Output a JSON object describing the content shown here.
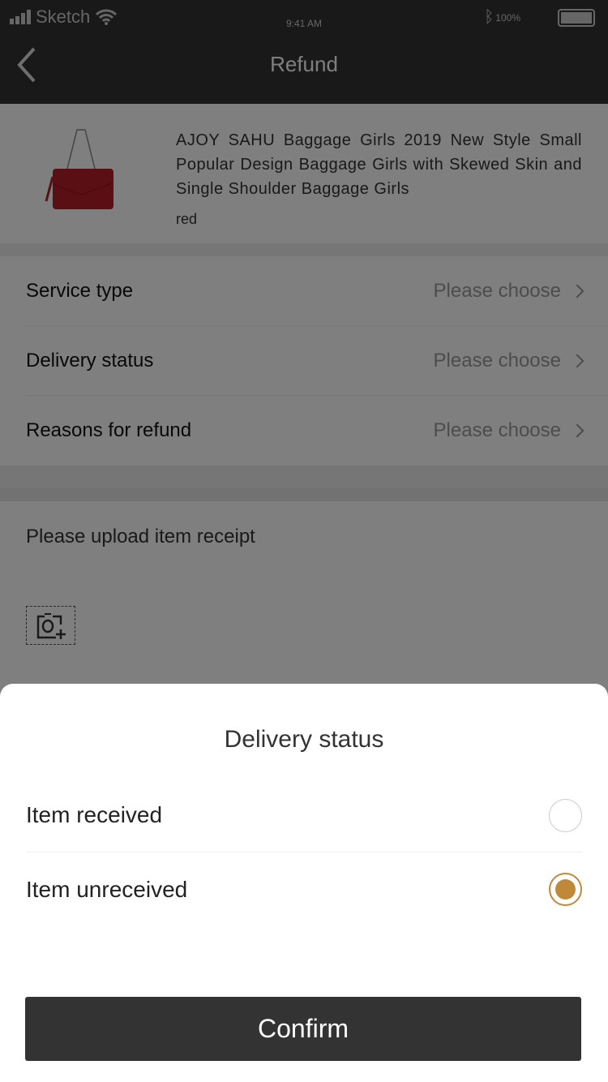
{
  "status_bar": {
    "carrier": "Sketch",
    "time": "9:41 AM",
    "battery": "100%"
  },
  "nav": {
    "title": "Refund"
  },
  "product": {
    "title": "AJOY SAHU Baggage Girls 2019 New Style Small Popular Design Baggage Girls with Skewed Skin and Single Shoulder Baggage Girls",
    "color": "red"
  },
  "form": {
    "rows": [
      {
        "label": "Service type",
        "value": "Please choose"
      },
      {
        "label": "Delivery status",
        "value": "Please choose"
      },
      {
        "label": "Reasons for refund",
        "value": "Please choose"
      }
    ],
    "upload_label": "Please upload item receipt"
  },
  "sheet": {
    "title": "Delivery status",
    "options": [
      {
        "label": "Item received",
        "selected": false
      },
      {
        "label": "Item unreceived",
        "selected": true
      }
    ],
    "confirm": "Confirm"
  },
  "colors": {
    "accent": "#c0893a",
    "dark": "#333333"
  }
}
